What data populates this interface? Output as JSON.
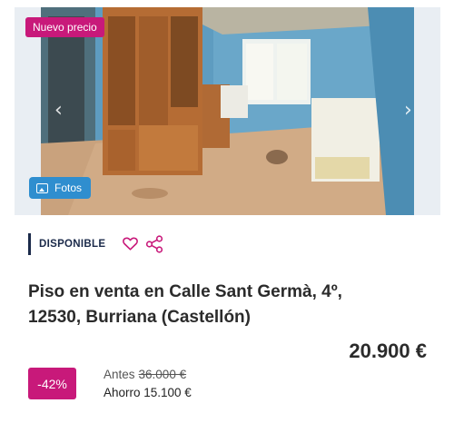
{
  "listing": {
    "new_price_badge": "Nuevo precio",
    "photos_button": "Fotos",
    "status": "DISPONIBLE",
    "title_line1": "Piso en venta en Calle Sant Germà, 4º,",
    "title_line2": "12530, Burriana (Castellón)",
    "price": "20.900 €",
    "discount": "-42%",
    "before_label": "Antes",
    "before_price": "36.000 €",
    "now_label": "Ahorro 15.100 €"
  },
  "icons": {
    "prev": "chevron-left-icon",
    "next": "chevron-right-icon",
    "photos": "image-icon",
    "favorite": "heart-icon",
    "share": "share-icon"
  },
  "colors": {
    "badge": "#c8197a",
    "fotos": "#2f8ecf",
    "status_bar": "#1b2a4a",
    "heart": "#c8197a"
  }
}
